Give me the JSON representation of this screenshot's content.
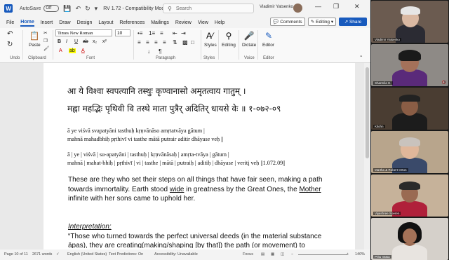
{
  "titlebar": {
    "app_icon": "W",
    "autosave_label": "AutoSave",
    "autosave_state": "Off",
    "doc_title": "RV 1.72 - Compatibility Mode • Saved",
    "search_placeholder": "Search",
    "user_name": "Vladimir Yatsenko",
    "window_controls": [
      "—",
      "❐",
      "✕"
    ]
  },
  "menu": {
    "tabs": [
      "File",
      "Home",
      "Insert",
      "Draw",
      "Design",
      "Layout",
      "References",
      "Mailings",
      "Review",
      "View",
      "Help"
    ],
    "active_tab": "Home",
    "comments_label": "Comments",
    "editing_label": "Editing",
    "share_label": "Share"
  },
  "ribbon": {
    "undo_label": "Undo",
    "clipboard_label": "Clipboard",
    "paste_label": "Paste",
    "font_name": "Times New Roman",
    "font_size": "10",
    "font_label": "Font",
    "paragraph_label": "Paragraph",
    "styles_btn": "Styles",
    "styles_label": "Styles",
    "editing_btn": "Editing",
    "dictate_btn": "Dictate",
    "voice_label": "Voice",
    "editor_btn": "Editor",
    "editor_label": "Editor",
    "format_buttons": [
      "B",
      "I",
      "U",
      "ab",
      "x₂",
      "x²"
    ]
  },
  "document": {
    "devanagari_line1": "आ ये विश्वा स्वपत्यानि तस्थुः कृण्वानासो अमृतत्वाय गातुम् ।",
    "devanagari_line2": "मह्ना महद्भिः पृथिवी वि तस्थे माता पुत्रैर् अदितिर् धायसे वेः ॥ १-०७२-०९",
    "translit_line1": "ā ye viśvā svapatyāni tasthuḥ kṛṇvānāso amṛtatvāya gātum |",
    "translit_line2": "mahnā mahadbhiḥ pṛthivī vi tasthe mātā putrair aditir dhāyase veḥ ||",
    "padapatha_line1": "ā | ye | viśvā | su-apatyāni | tasthuḥ | kṛṇvānāsaḥ | amṛta-tvāya | gātum |",
    "padapatha_line2": "mahnā | mahat-bhiḥ | pṛthivī | vi | tasthe | mātā | putraiḥ | aditiḥ | dhāyase | veritį veḥ ||1.072.09||",
    "para_part1": "These are they who set their steps on all things that have fair seen, making a path towards immortality. Earth stood ",
    "para_wide": "wide",
    "para_part2": " in greatness by the Great Ones, the ",
    "para_mother": "Mother",
    "para_part3": " infinite with her sons came to uphold her.",
    "interpretation_heading": "Interpretation:",
    "quote_line1": "“Those who turned towards the perfect universal deeds (in the material substance",
    "quote_line2": "āpas), they are creating(making/shaping [by that]) the path (or movement) to"
  },
  "status": {
    "page": "Page 10 of 11",
    "words": "2671 words",
    "language": "English (United States)",
    "predictions": "Text Predictions: On",
    "accessibility": "Accessibility: Unavailable",
    "focus": "Focus",
    "zoom": "140%"
  },
  "participants": [
    {
      "name": "Vladimir Yatsenko"
    },
    {
      "name": "Sharmila H."
    },
    {
      "name": "Kilohn"
    },
    {
      "name": "Martha & Robert Orton"
    },
    {
      "name": "Vijaishree Soeren"
    },
    {
      "name": "Pritu Vatsa"
    }
  ]
}
